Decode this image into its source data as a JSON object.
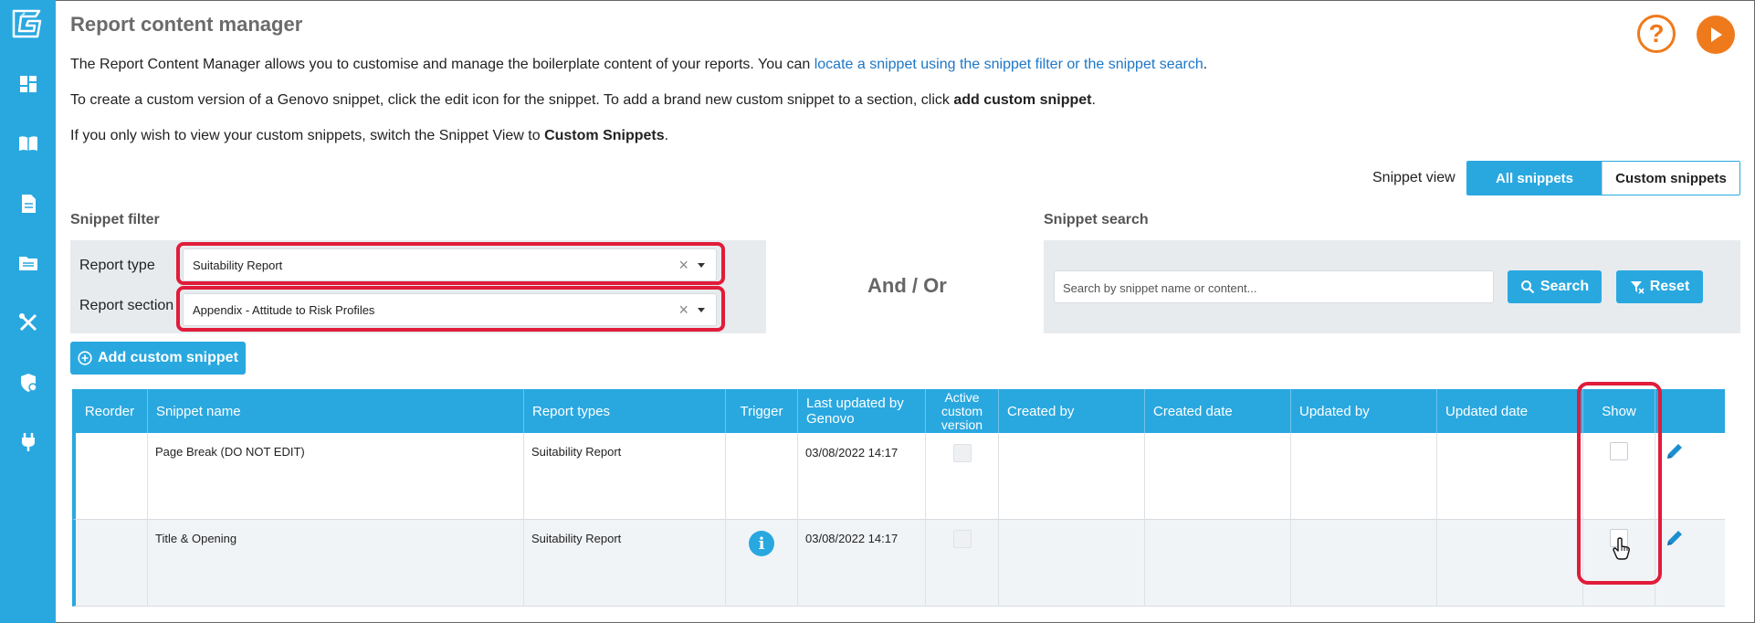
{
  "app": {
    "title": "Report content manager"
  },
  "sidebar": {
    "items": [
      {
        "name": "dashboard-icon"
      },
      {
        "name": "book-icon"
      },
      {
        "name": "document-icon"
      },
      {
        "name": "folder-icon"
      },
      {
        "name": "tools-icon"
      },
      {
        "name": "shield-icon"
      },
      {
        "name": "plug-icon"
      }
    ]
  },
  "intro": {
    "p1_prefix": "The Report Content Manager allows you to customise and manage the boilerplate content of your reports. You can ",
    "p1_link": "locate a snippet using the snippet filter or the snippet search",
    "p1_suffix": ".",
    "p2_prefix": "To create a custom version of a Genovo snippet, click the edit icon for the snippet. To add a brand new custom snippet to a section, click ",
    "p2_bold": "add custom snippet",
    "p2_suffix": ".",
    "p3_prefix": "If you only wish to view your custom snippets, switch the Snippet View to ",
    "p3_bold": "Custom Snippets",
    "p3_suffix": "."
  },
  "header_buttons": {
    "help": "?"
  },
  "snippet_view": {
    "label": "Snippet view",
    "options": [
      "All snippets",
      "Custom snippets"
    ],
    "selected": "All snippets"
  },
  "filter": {
    "title": "Snippet filter",
    "report_type_label": "Report type",
    "report_type_value": "Suitability Report",
    "report_section_label": "Report section",
    "report_section_value": "Appendix - Attitude to Risk Profiles",
    "clear_symbol": "×"
  },
  "and_or": "And / Or",
  "search": {
    "title": "Snippet search",
    "placeholder": "Search by snippet name or content...",
    "search_label": "Search",
    "reset_label": "Reset"
  },
  "add_custom_snippet": "Add custom snippet",
  "table": {
    "columns": {
      "reorder": "Reorder",
      "name": "Snippet name",
      "types": "Report types",
      "trigger": "Trigger",
      "last_updated_l1": "Last updated by",
      "last_updated_l2": "Genovo",
      "active_l1": "Active",
      "active_l2": "custom",
      "active_l3": "version",
      "created_by": "Created by",
      "created_date": "Created date",
      "updated_by": "Updated by",
      "updated_date": "Updated date",
      "show": "Show"
    },
    "rows": [
      {
        "name": "Page Break (DO NOT EDIT)",
        "types": "Suitability Report",
        "trigger": "",
        "last_updated": "03/08/2022 14:17",
        "active_custom": false,
        "show": false
      },
      {
        "name": "Title & Opening",
        "types": "Suitability Report",
        "trigger": "i",
        "last_updated": "03/08/2022 14:17",
        "active_custom": false,
        "show": false
      }
    ]
  },
  "colors": {
    "accent": "#29a8e0",
    "highlight": "#e01c3a",
    "orange": "#ef7a1c"
  }
}
